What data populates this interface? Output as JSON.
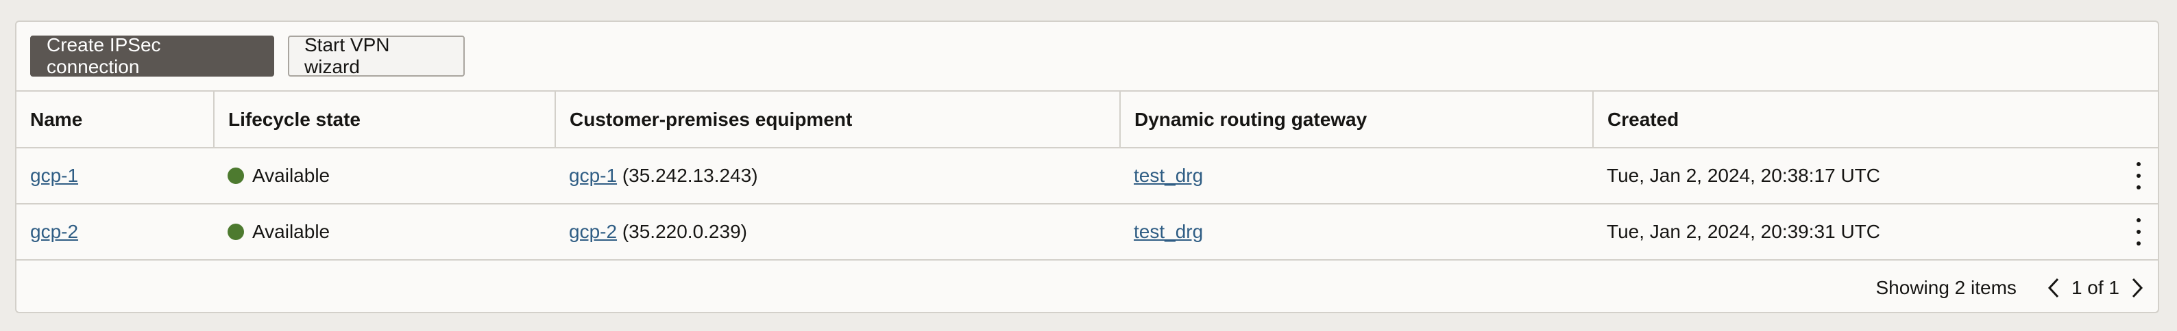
{
  "toolbar": {
    "create_label": "Create IPSec connection",
    "wizard_label": "Start VPN wizard"
  },
  "table": {
    "columns": [
      "Name",
      "Lifecycle state",
      "Customer-premises equipment",
      "Dynamic routing gateway",
      "Created"
    ],
    "rows": [
      {
        "name": "gcp-1",
        "state": "Available",
        "cpe_name": "gcp-1",
        "cpe_ip": " (35.242.13.243)",
        "drg": "test_drg",
        "created": "Tue, Jan 2, 2024, 20:38:17 UTC"
      },
      {
        "name": "gcp-2",
        "state": "Available",
        "cpe_name": "gcp-2",
        "cpe_ip": " (35.220.0.239)",
        "drg": "test_drg",
        "created": "Tue, Jan 2, 2024, 20:39:31 UTC"
      }
    ]
  },
  "footer": {
    "showing": "Showing 2 items",
    "page": "1 of 1"
  },
  "colors": {
    "status_available": "#4d7a2f",
    "link": "#2f5d84",
    "primary_button": "#5b5652"
  },
  "icons": [
    "more-actions-icon",
    "chevron-left-icon",
    "chevron-right-icon",
    "status-available-icon"
  ]
}
